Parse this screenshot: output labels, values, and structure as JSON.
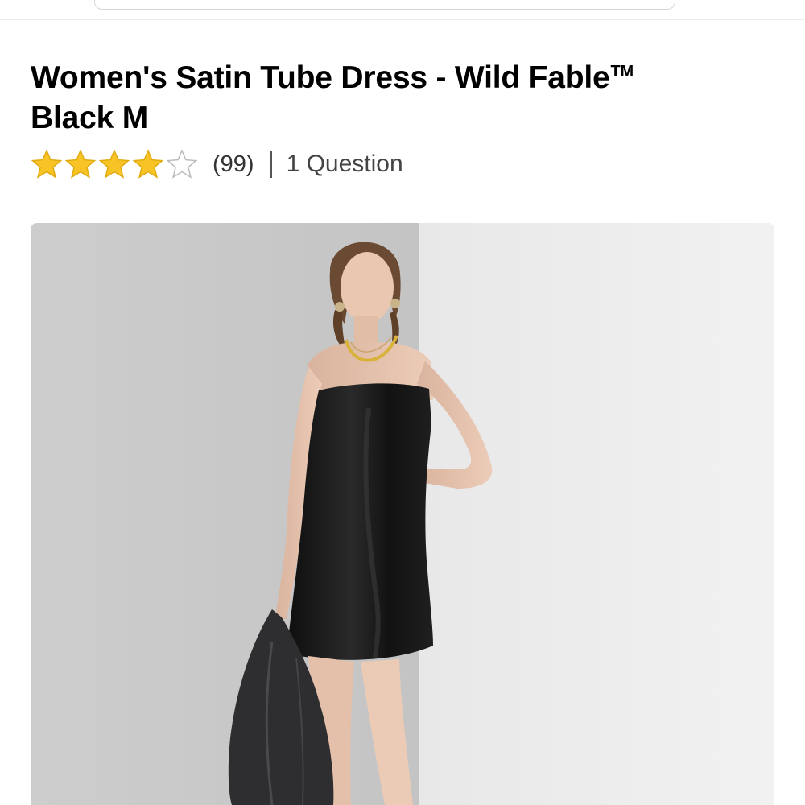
{
  "product": {
    "title": "Women's Satin Tube Dress - Wild Fable",
    "trademark": "TM",
    "variant": "Black M",
    "rating": 4,
    "rating_max": 5,
    "reviews_count": "(99)",
    "questions_link": "1 Question"
  },
  "image": {
    "icon": "product-photo",
    "colors": {
      "backdrop_left": "#cfcfcf",
      "backdrop_right": "#efefef",
      "dress": "#141414",
      "skin": "#e6c3ad",
      "hair": "#6b4a33",
      "jacket": "#2e2e30"
    }
  },
  "colors": {
    "star_filled": "#f7c325",
    "star_outline": "#bbbbbb",
    "text": "#000000"
  }
}
